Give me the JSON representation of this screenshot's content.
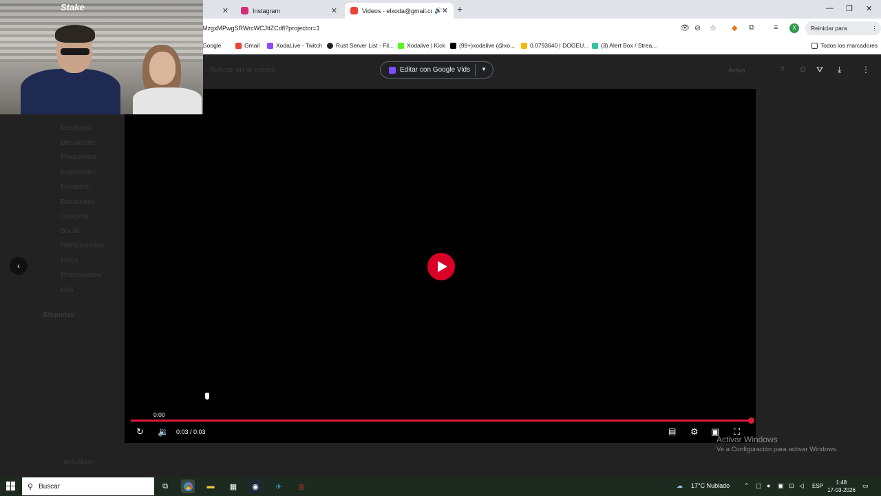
{
  "tabs": [
    {
      "title": "",
      "active": false
    },
    {
      "title": "Instagram",
      "active": false,
      "color": "#d62976"
    },
    {
      "title": "Videos - elxoda@gmail.com",
      "active": true,
      "color": "#ea4335"
    }
  ],
  "address": {
    "url": "MzgxMPwgSRWrcWCJltZCdfl?projector=1"
  },
  "browser": {
    "update_label": "Reiniciar para actualizar",
    "profile_initial": "X"
  },
  "bookmarks": {
    "items": [
      "Google",
      "Gmail",
      "XodaLive - Twitch",
      "Rust Server List - Fil...",
      "Xodalive | Kick",
      "(99+)xodalive (@xo...",
      "0.0793640 | DOGEU...",
      "(3) Alert Box / Strea..."
    ],
    "all_label": "Todos los marcadores"
  },
  "gmail": {
    "search_placeholder": "Buscar en el correo",
    "status": "Activo",
    "nav_items": [
      "Recibidos",
      "Destacados",
      "Pospuestos",
      "Importantes",
      "Enviados",
      "Borradores",
      "Compras",
      "Social",
      "Notificaciones",
      "Foros",
      "Promociones",
      "Más"
    ],
    "labels_title": "Etiquetas",
    "update_text": "Actualizar"
  },
  "viewer": {
    "edit_button": "Editar con Google Vids",
    "scrub_time": "0:00",
    "time_display": "0:03 / 0:03",
    "progress": 1.0
  },
  "webcam": {
    "brand": "Stake"
  },
  "watermark": {
    "line1": "Activar Windows",
    "line2": "Ve a Configuración para activar Windows."
  },
  "taskbar": {
    "search_placeholder": "Buscar",
    "weather": "17°C  Nublado",
    "lang": "ESP",
    "time": "1:48",
    "date": "17-03-2026"
  }
}
